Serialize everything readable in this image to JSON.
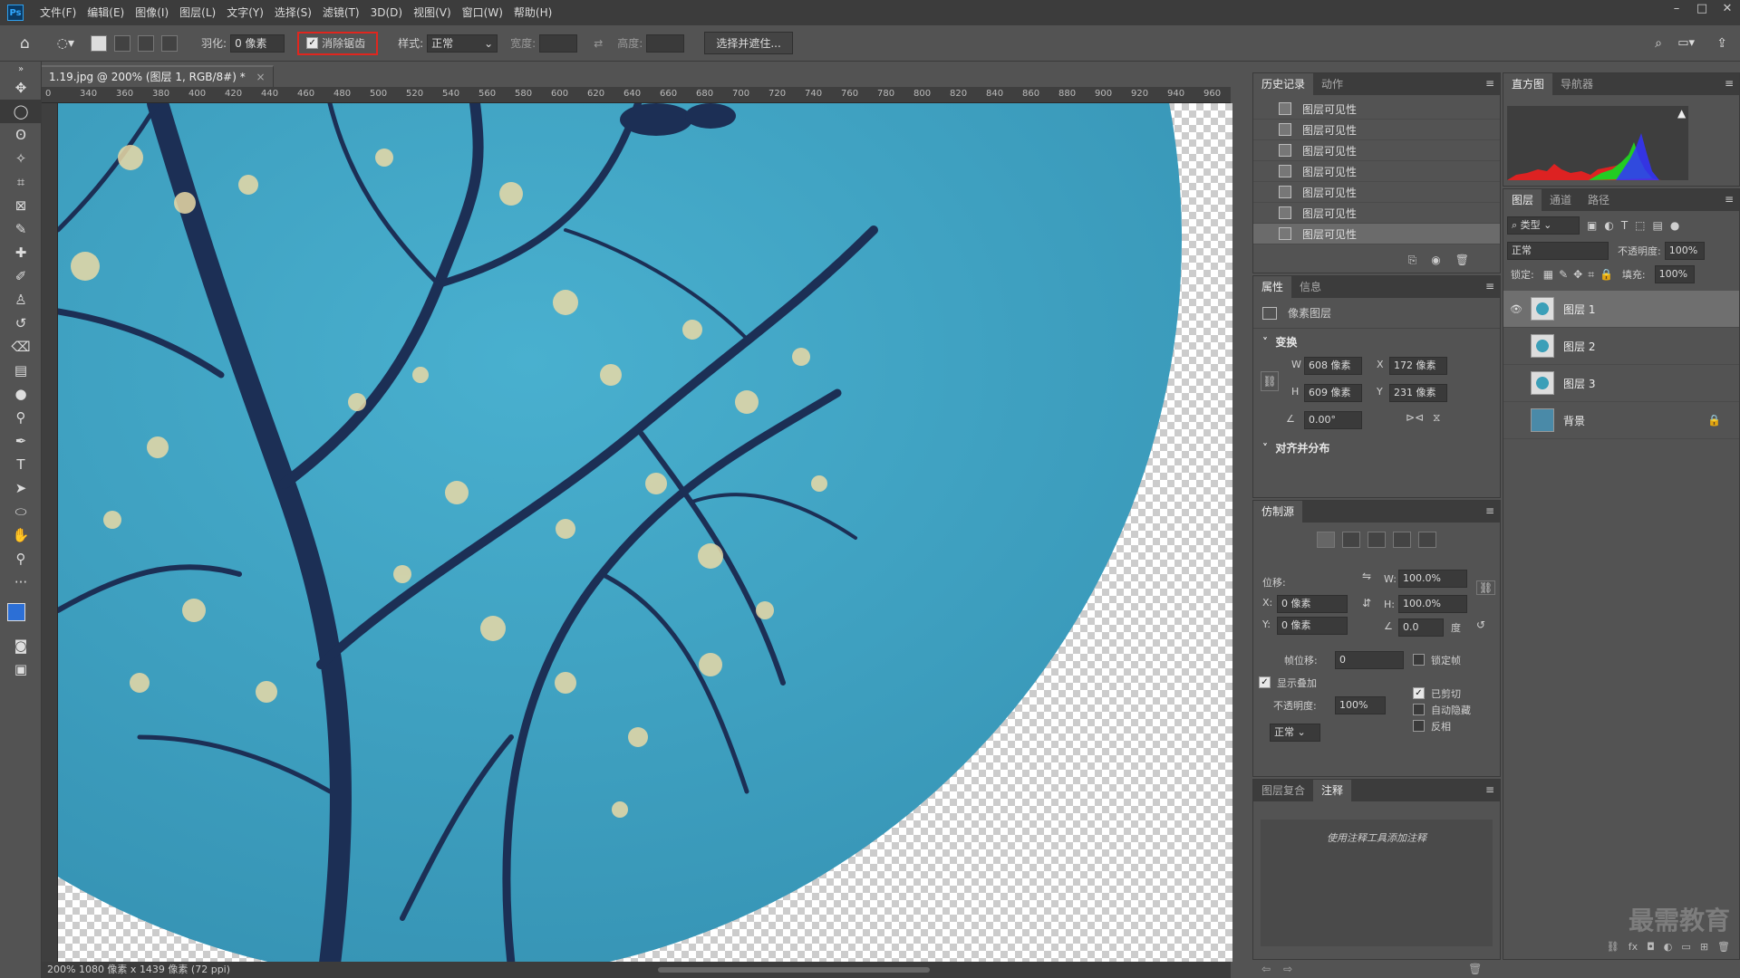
{
  "menubar": {
    "logo": "Ps",
    "items": [
      "文件(F)",
      "编辑(E)",
      "图像(I)",
      "图层(L)",
      "文字(Y)",
      "选择(S)",
      "滤镜(T)",
      "3D(D)",
      "视图(V)",
      "窗口(W)",
      "帮助(H)"
    ]
  },
  "options": {
    "feather_label": "羽化:",
    "feather_value": "0 像素",
    "antialias_label": "消除锯齿",
    "style_label": "样式:",
    "style_value": "正常",
    "width_label": "宽度:",
    "height_label": "高度:",
    "select_mask_button": "选择并遮住...",
    "highlight_color": "#e0261e"
  },
  "document": {
    "tab_title": "1.19.jpg @ 200% (图层 1, RGB/8#) *",
    "ruler_ticks": [
      "0",
      "340",
      "360",
      "380",
      "400",
      "420",
      "440",
      "460",
      "480",
      "500",
      "520",
      "540",
      "560",
      "580",
      "600",
      "620",
      "640",
      "660",
      "680",
      "700",
      "720",
      "740",
      "760",
      "780",
      "800",
      "820",
      "840",
      "860",
      "880",
      "900",
      "920",
      "940",
      "960"
    ],
    "status": "200%   1080 像素 x 1439 像素 (72 ppi)"
  },
  "history_panel": {
    "tabs": [
      "历史记录",
      "动作"
    ],
    "items": [
      "图层可见性",
      "图层可见性",
      "图层可见性",
      "图层可见性",
      "图层可见性",
      "图层可见性",
      "图层可见性"
    ]
  },
  "properties_panel": {
    "tabs": [
      "属性",
      "信息"
    ],
    "layer_type": "像素图层",
    "transform_title": "变换",
    "w_label": "W",
    "w_value": "608 像素",
    "x_label": "X",
    "x_value": "172 像素",
    "h_label": "H",
    "h_value": "609 像素",
    "y_label": "Y",
    "y_value": "231 像素",
    "angle_value": "0.00°",
    "align_title": "对齐并分布"
  },
  "clone_panel": {
    "title": "仿制源",
    "offset_label": "位移:",
    "x_label": "X:",
    "x_value": "0 像素",
    "y_label": "Y:",
    "y_value": "0 像素",
    "w_label": "W:",
    "w_value": "100.0%",
    "h_label": "H:",
    "h_value": "100.0%",
    "angle_value": "0.0",
    "degree_label": "度",
    "frame_offset_label": "帧位移:",
    "frame_offset_value": "0",
    "lock_frame_label": "锁定帧",
    "show_overlay_label": "显示叠加",
    "opacity_label": "不透明度:",
    "opacity_value": "100%",
    "clipped_label": "已剪切",
    "auto_hide_label": "自动隐藏",
    "invert_label": "反相",
    "blend_value": "正常"
  },
  "notes_panel": {
    "tabs": [
      "图层复合",
      "注释"
    ],
    "hint": "使用注释工具添加注释"
  },
  "histogram_panel": {
    "tabs": [
      "直方图",
      "导航器"
    ]
  },
  "layers_panel": {
    "tabs": [
      "图层",
      "通道",
      "路径"
    ],
    "filter_value": "类型",
    "blend_value": "正常",
    "opacity_label": "不透明度:",
    "opacity_value": "100%",
    "lock_label": "锁定:",
    "fill_label": "填充:",
    "fill_value": "100%",
    "layers": [
      {
        "name": "图层 1",
        "visible": true,
        "selected": true
      },
      {
        "name": "图层 2",
        "visible": false,
        "selected": false
      },
      {
        "name": "图层 3",
        "visible": false,
        "selected": false
      },
      {
        "name": "背景",
        "visible": false,
        "selected": false,
        "locked": true
      }
    ]
  },
  "watermark": "最需教育",
  "colors": {
    "sky": "#3fa4c4",
    "branch": "#1c2f55",
    "blossom": "#e9d9a6"
  }
}
